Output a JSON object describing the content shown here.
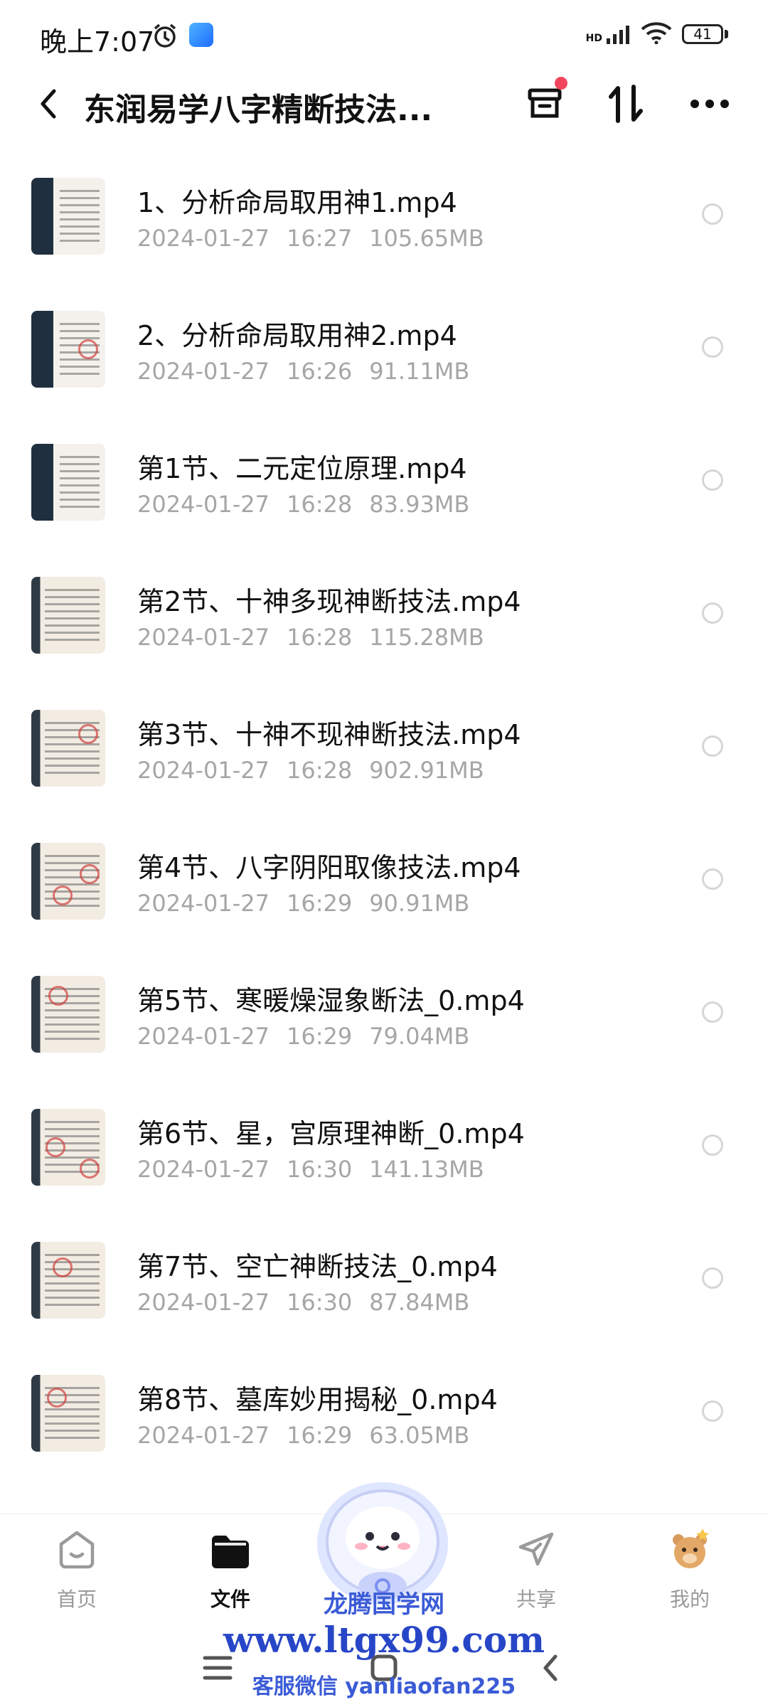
{
  "status": {
    "time": "晚上7:07",
    "network": "HD",
    "battery": "41"
  },
  "header": {
    "title": "东润易学八字精断技法..."
  },
  "files": [
    {
      "name": "1、分析命局取用神1.mp4",
      "date": "2024-01-27",
      "time": "16:27",
      "size": "105.65MB"
    },
    {
      "name": "2、分析命局取用神2.mp4",
      "date": "2024-01-27",
      "time": "16:26",
      "size": "91.11MB"
    },
    {
      "name": "第1节、二元定位原理.mp4",
      "date": "2024-01-27",
      "time": "16:28",
      "size": "83.93MB"
    },
    {
      "name": "第2节、十神多现神断技法.mp4",
      "date": "2024-01-27",
      "time": "16:28",
      "size": "115.28MB"
    },
    {
      "name": "第3节、十神不现神断技法.mp4",
      "date": "2024-01-27",
      "time": "16:28",
      "size": "902.91MB"
    },
    {
      "name": "第4节、八字阴阳取像技法.mp4",
      "date": "2024-01-27",
      "time": "16:29",
      "size": "90.91MB"
    },
    {
      "name": "第5节、寒暖燥湿象断法_0.mp4",
      "date": "2024-01-27",
      "time": "16:29",
      "size": "79.04MB"
    },
    {
      "name": "第6节、星，宫原理神断_0.mp4",
      "date": "2024-01-27",
      "time": "16:30",
      "size": "141.13MB"
    },
    {
      "name": "第7节、空亡神断技法_0.mp4",
      "date": "2024-01-27",
      "time": "16:30",
      "size": "87.84MB"
    },
    {
      "name": "第8节、墓库妙用揭秘_0.mp4",
      "date": "2024-01-27",
      "time": "16:29",
      "size": "63.05MB"
    }
  ],
  "tabs": [
    {
      "label": "首页"
    },
    {
      "label": "文件"
    },
    {
      "label": ""
    },
    {
      "label": "共享"
    },
    {
      "label": "我的"
    }
  ],
  "watermark": {
    "line1": "龙腾国学网",
    "line2": "www.ltgx99.com",
    "line3": "客服微信 yanliaofan225"
  },
  "colors": {
    "accent": "#111111",
    "badge": "#f2465d",
    "meta": "#a6a6a6"
  }
}
